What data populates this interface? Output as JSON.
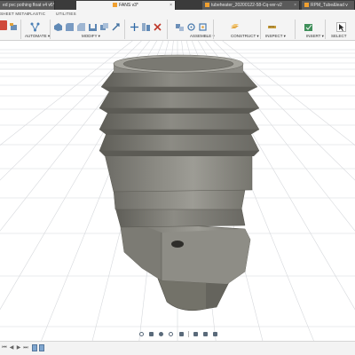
{
  "tabs": [
    {
      "label": "ed pvc pothing float v4 v5*",
      "active": false
    },
    {
      "label": "FANS v3*",
      "active": true
    },
    {
      "label": "tubeheater_20200122-58-Cq-ver-v2",
      "active": false
    },
    {
      "label": "RPM_Tube&lead v",
      "active": false
    }
  ],
  "ribbon": {
    "section_tabs": [
      "SHEET METAL",
      "PLASTIC",
      "UTILITIES"
    ],
    "groups": [
      {
        "label": "AUTOMATE ▾",
        "icon": "automate-icon"
      },
      {
        "label": "MODIFY ▾",
        "icon": "modify-icon"
      },
      {
        "label": "ASSEMBLE ▾",
        "icon": "assemble-icon"
      },
      {
        "label": "CONSTRUCT ▾",
        "icon": "construct-icon"
      },
      {
        "label": "INSPECT ▾",
        "icon": "inspect-icon"
      },
      {
        "label": "INSERT ▾",
        "icon": "insert-icon"
      },
      {
        "label": "SELECT",
        "icon": "select-icon"
      }
    ]
  },
  "viewport": {
    "model": "hose-barb-fitting",
    "model_color": "#8a8880",
    "grid_color": "#d2d4d8"
  },
  "navbar": {
    "tools": [
      "orbit-icon",
      "look-at-icon",
      "pan-icon",
      "zoom-icon",
      "fit-icon",
      "display-settings-icon",
      "grid-settings-icon",
      "viewports-icon"
    ]
  },
  "timeline": {
    "controls": [
      "⏮",
      "◀",
      "▶",
      "⏭"
    ]
  }
}
